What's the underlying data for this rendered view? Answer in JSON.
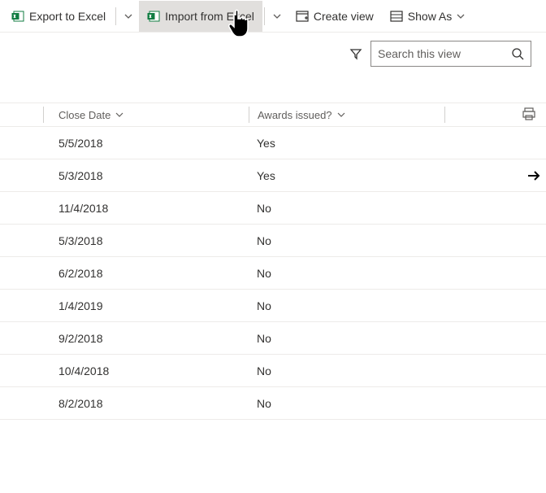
{
  "toolbar": {
    "export_label": "Export to Excel",
    "import_label": "Import from Excel",
    "create_view_label": "Create view",
    "show_as_label": "Show As"
  },
  "search": {
    "placeholder": "Search this view"
  },
  "columns": {
    "close_date": "Close Date",
    "awards_issued": "Awards issued?"
  },
  "rows": [
    {
      "close_date": "5/5/2018",
      "awards": "Yes",
      "arrow": false
    },
    {
      "close_date": "5/3/2018",
      "awards": "Yes",
      "arrow": true
    },
    {
      "close_date": "11/4/2018",
      "awards": "No",
      "arrow": false
    },
    {
      "close_date": "5/3/2018",
      "awards": "No",
      "arrow": false
    },
    {
      "close_date": "6/2/2018",
      "awards": "No",
      "arrow": false
    },
    {
      "close_date": "1/4/2019",
      "awards": "No",
      "arrow": false
    },
    {
      "close_date": "9/2/2018",
      "awards": "No",
      "arrow": false
    },
    {
      "close_date": "10/4/2018",
      "awards": "No",
      "arrow": false
    },
    {
      "close_date": "8/2/2018",
      "awards": "No",
      "arrow": false
    }
  ]
}
